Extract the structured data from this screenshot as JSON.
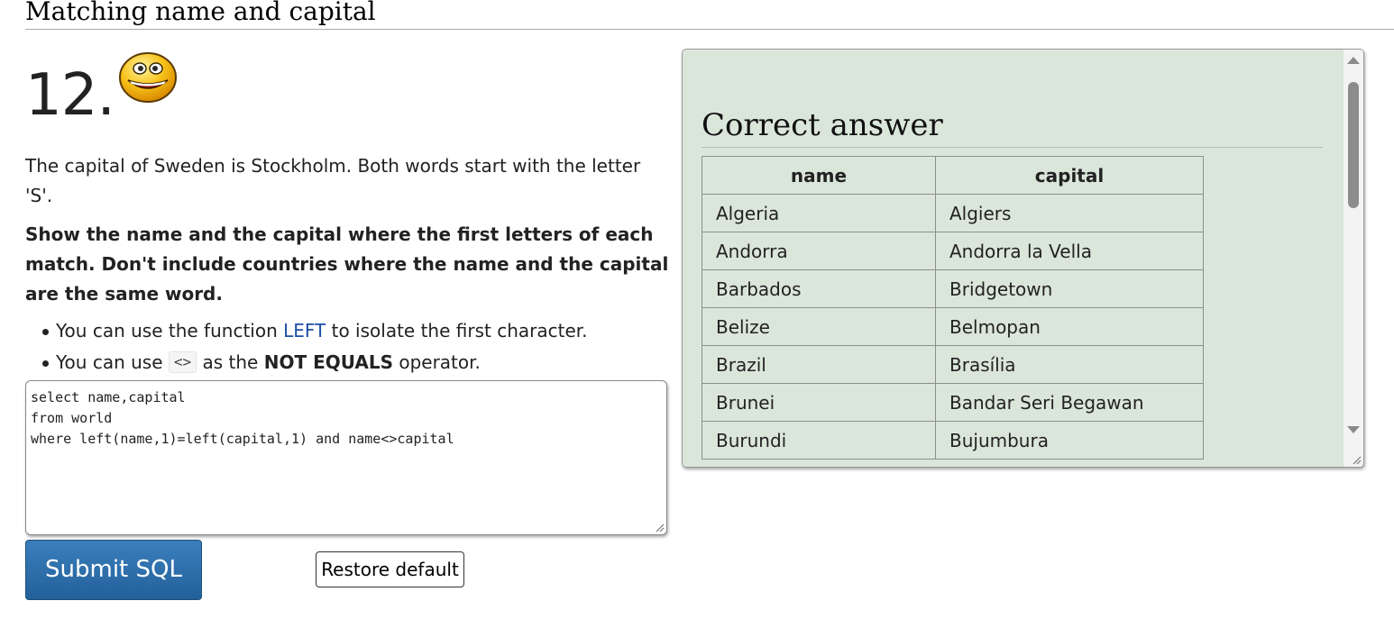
{
  "header": {
    "title": "Matching name and capital"
  },
  "question": {
    "number": "12.",
    "smiley_icon": "grinning-face-icon",
    "intro": "The capital of Sweden is Stockholm. Both words start with the letter 'S'.",
    "instruction": "Show the name and the capital where the first letters of each match. Don't include countries where the name and the capital are the same word.",
    "hints": {
      "h1_prefix": "You can use the function ",
      "h1_link": "LEFT",
      "h1_suffix": " to isolate the first character.",
      "h2_prefix": "You can use ",
      "h2_code": "<>",
      "h2_middle": " as the ",
      "h2_bold": "NOT EQUALS",
      "h2_suffix": " operator."
    }
  },
  "editor": {
    "sql": "select name,capital\nfrom world\nwhere left(name,1)=left(capital,1) and name<>capital"
  },
  "buttons": {
    "submit_label": "Submit SQL",
    "restore_label": "Restore default"
  },
  "answer": {
    "title": "Correct answer",
    "columns": [
      "name",
      "capital"
    ],
    "rows": [
      [
        "Algeria",
        "Algiers"
      ],
      [
        "Andorra",
        "Andorra la Vella"
      ],
      [
        "Barbados",
        "Bridgetown"
      ],
      [
        "Belize",
        "Belmopan"
      ],
      [
        "Brazil",
        "Brasília"
      ],
      [
        "Brunei",
        "Bandar Seri Begawan"
      ],
      [
        "Burundi",
        "Bujumbura"
      ]
    ]
  },
  "colors": {
    "submit_bg": "#2a6aa8",
    "panel_bg": "#dbe6db",
    "link": "#1a4fa3"
  }
}
